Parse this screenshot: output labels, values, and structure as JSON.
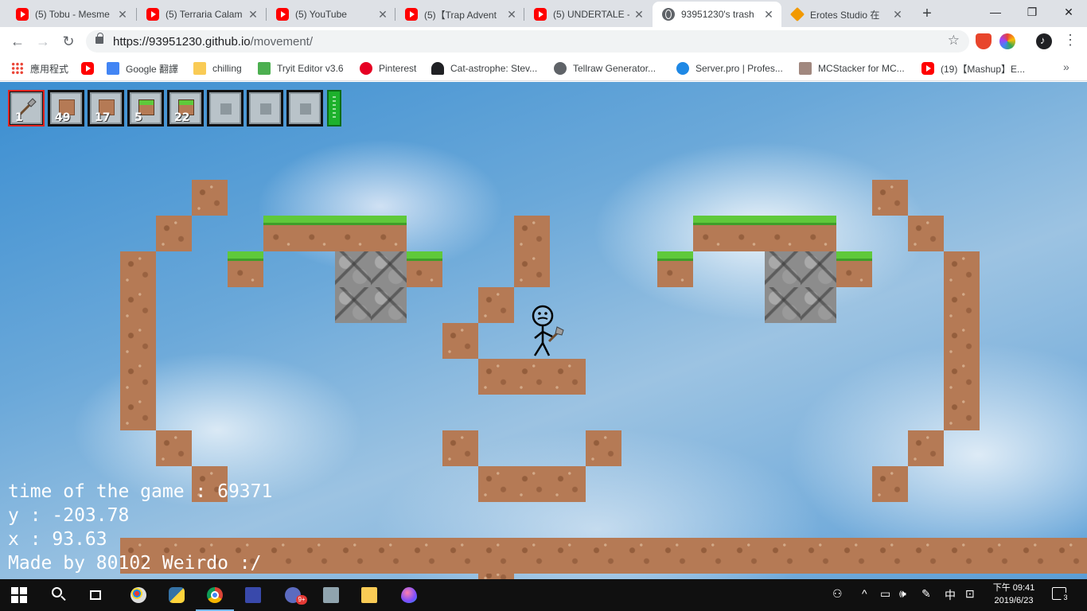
{
  "browser": {
    "tabs": [
      {
        "title": "(5) Tobu - Mesme",
        "icon": "youtube-icon"
      },
      {
        "title": "(5) Terraria Calam",
        "icon": "youtube-icon"
      },
      {
        "title": "(5) YouTube",
        "icon": "youtube-icon"
      },
      {
        "title": "(5)【Trap Advent",
        "icon": "youtube-icon"
      },
      {
        "title": "(5) UNDERTALE -",
        "icon": "youtube-icon"
      },
      {
        "title": "93951230's trash",
        "icon": "globe-icon",
        "active": true
      },
      {
        "title": "Erotes Studio 在",
        "icon": "erotes-icon"
      }
    ],
    "close_glyph": "✕",
    "new_tab_glyph": "+",
    "window_controls": {
      "minimize": "—",
      "maximize": "❐",
      "close": "✕"
    },
    "nav": {
      "back": "←",
      "forward": "→",
      "reload": "↻"
    },
    "address": {
      "host": "https://93951230.github.io",
      "path": "/movement/"
    },
    "star_glyph": "☆",
    "menu_glyph": "⋮",
    "bookmarks": [
      {
        "label": "應用程式",
        "icon": "apps-icon"
      },
      {
        "label": "",
        "icon": "youtube-icon"
      },
      {
        "label": "Google 翻譯",
        "icon": "google-translate-icon"
      },
      {
        "label": "chilling",
        "icon": "folder-icon"
      },
      {
        "label": "Tryit Editor v3.6",
        "icon": "w3schools-icon"
      },
      {
        "label": "Pinterest",
        "icon": "pinterest-icon"
      },
      {
        "label": "Cat-astrophe: Stev...",
        "icon": "cat-icon"
      },
      {
        "label": "Tellraw Generator...",
        "icon": "globe-icon"
      },
      {
        "label": "Server.pro | Profes...",
        "icon": "server-icon"
      },
      {
        "label": "MCStacker for MC...",
        "icon": "mcstacker-icon"
      },
      {
        "label": "(19)【Mashup】E...",
        "icon": "youtube-icon"
      }
    ],
    "bookmarks_more": "»"
  },
  "game": {
    "hotbar": [
      {
        "count": "1",
        "item": "shovel",
        "selected": true
      },
      {
        "count": "49",
        "item": "dirt"
      },
      {
        "count": "17",
        "item": "dirt"
      },
      {
        "count": "5",
        "item": "grass"
      },
      {
        "count": "22",
        "item": "grass"
      },
      {
        "count": "",
        "item": "empty"
      },
      {
        "count": "",
        "item": "empty"
      },
      {
        "count": "",
        "item": "empty"
      }
    ],
    "hud": {
      "time": "time of the game : 69371",
      "y": "y : -203.78",
      "x": "x : 93.63",
      "credit": "Made by 80102 Weirdo :/"
    }
  },
  "taskbar": {
    "apps": [
      "start-icon",
      "search-icon",
      "task-view-icon",
      "paint-icon",
      "python-icon",
      "chrome-icon",
      "vm-icon",
      "mail-icon",
      "this-pc-icon",
      "file-explorer-icon",
      "balloon-icon"
    ],
    "mail_badge": "9+",
    "tray": {
      "people": "⚇",
      "chevron": "^",
      "network": "▭",
      "volume": "🕪",
      "pen": "✎",
      "ime": "中",
      "action": "⊡"
    },
    "clock": {
      "time": "下午 09:41",
      "date": "2019/6/23"
    },
    "notifications": "3"
  }
}
